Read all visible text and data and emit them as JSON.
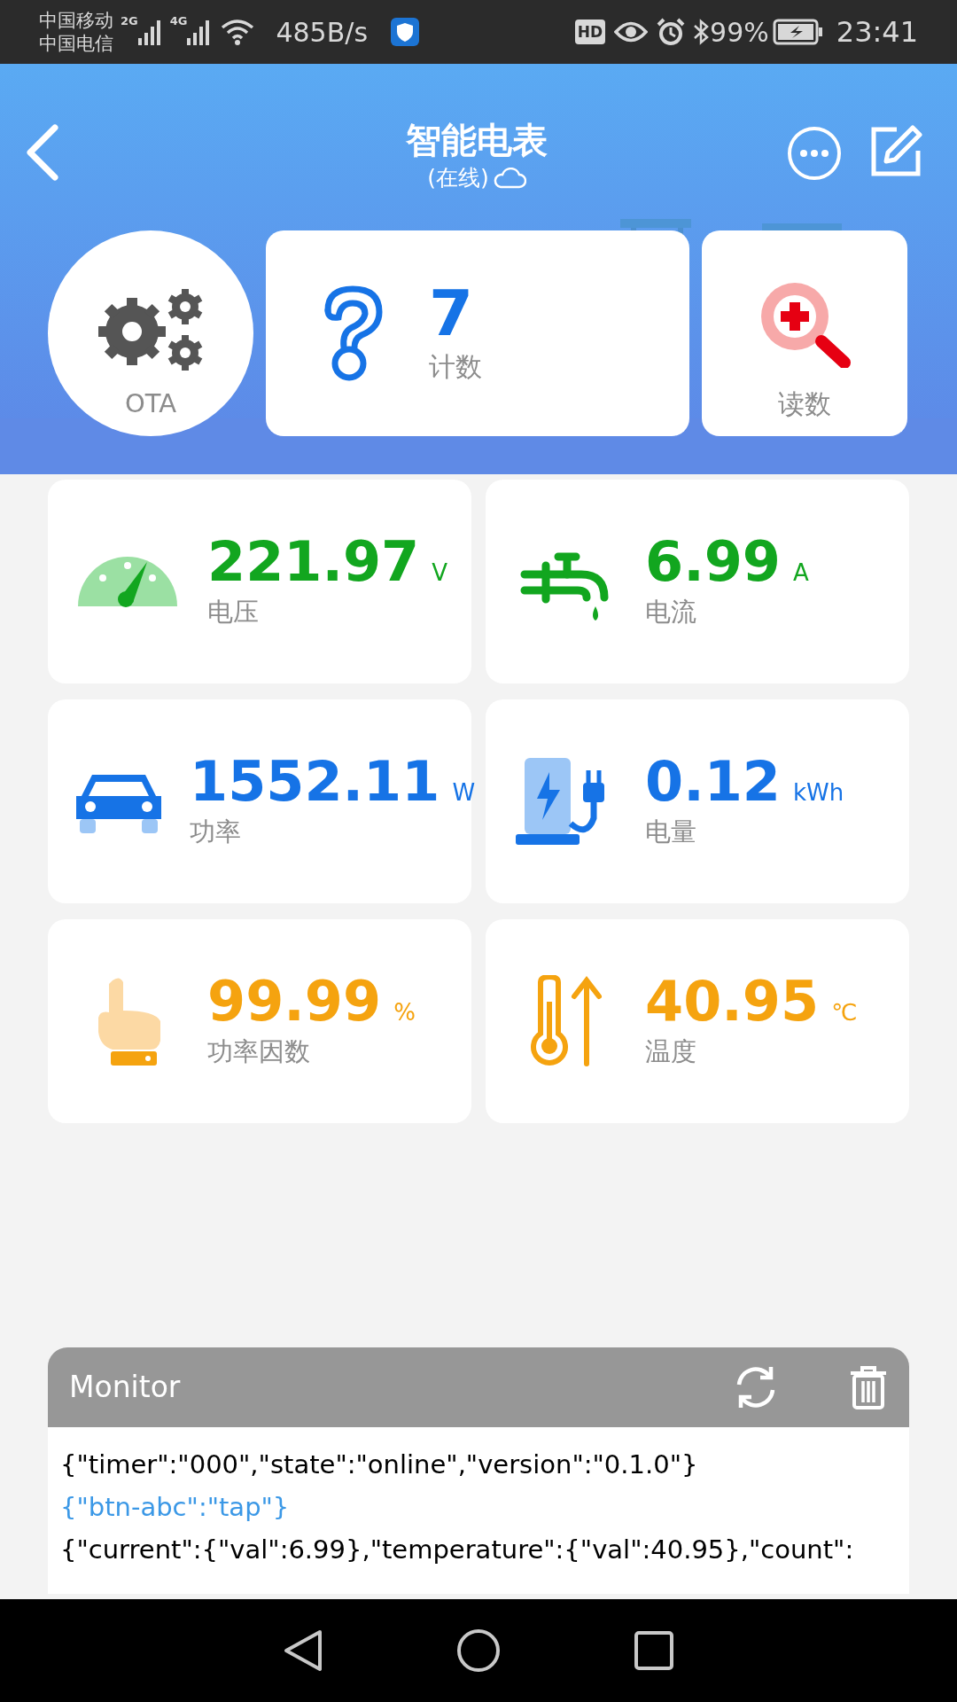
{
  "status_bar": {
    "carrier_1": "中国移动",
    "carrier_2": "中国电信",
    "net_1": "2G",
    "net_2": "4G",
    "speed": "485B/s",
    "hd": "HD",
    "battery": "99%",
    "time": "23:41"
  },
  "header": {
    "title": "智能电表",
    "status": "(在线)"
  },
  "top": {
    "ota_label": "OTA",
    "count_value": "7",
    "count_label": "计数",
    "read_label": "读数"
  },
  "tiles": [
    {
      "kind": "gauge",
      "value": "221.97",
      "unit": "V",
      "label": "电压",
      "color": "#12a61f"
    },
    {
      "kind": "faucet",
      "value": "6.99",
      "unit": "A",
      "label": "电流",
      "color": "#12a61f"
    },
    {
      "kind": "car",
      "value": "1552.11",
      "unit": "W",
      "label": "功率",
      "color": "#1673e6"
    },
    {
      "kind": "charger",
      "value": "0.12",
      "unit": "kWh",
      "label": "电量",
      "color": "#1673e6"
    },
    {
      "kind": "hand",
      "value": "99.99",
      "unit": "%",
      "label": "功率因数",
      "color": "#f5a30f"
    },
    {
      "kind": "thermo",
      "value": "40.95",
      "unit": "℃",
      "label": "温度",
      "color": "#f5a30f"
    }
  ],
  "monitor": {
    "title": "Monitor",
    "lines": [
      {
        "text": "{\"timer\":\"000\",\"state\":\"online\",\"version\":\"0.1.0\"}",
        "kind": "in"
      },
      {
        "text": "{\"btn-abc\":\"tap\"}",
        "kind": "out"
      },
      {
        "text": "{\"current\":{\"val\":6.99},\"temperature\":{\"val\":40.95},\"count\":",
        "kind": "in"
      }
    ]
  }
}
